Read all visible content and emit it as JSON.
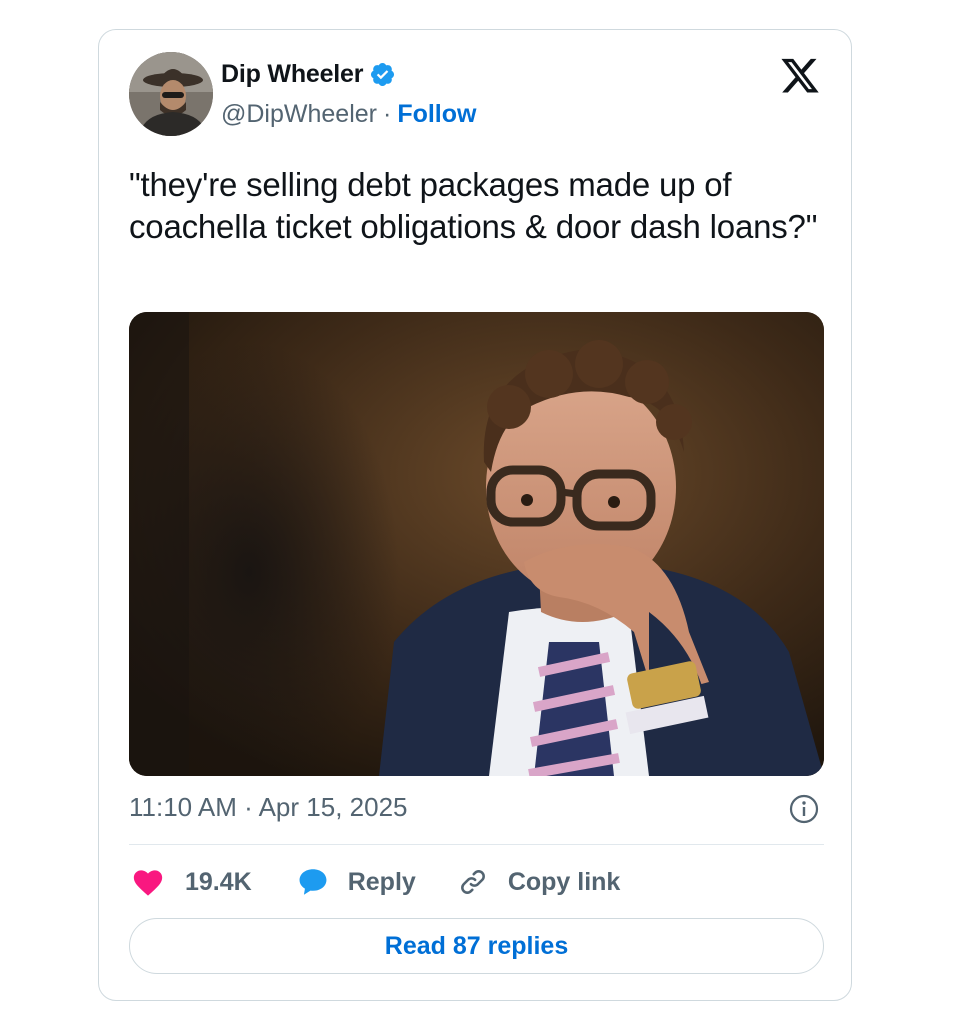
{
  "author": {
    "display_name": "Dip Wheeler",
    "handle": "@DipWheeler",
    "separator": "·",
    "follow_label": "Follow",
    "avatar_icon": "avatar-photo",
    "verified_icon": "verified-badge-icon",
    "verified_color": "#1d9bf0"
  },
  "platform_icon": "x-logo-icon",
  "tweet": {
    "text": "\"they're selling debt packages made up of coachella ticket obligations & door dash loans?\"",
    "media_icon": "tweet-photo",
    "timestamp": "11:10 AM · Apr 15, 2025"
  },
  "actions": {
    "like_count": "19.4K",
    "like_color": "#f91880",
    "reply_label": "Reply",
    "reply_color": "#1d9bf0",
    "copy_label": "Copy link"
  },
  "read_replies_label": "Read 87 replies",
  "colors": {
    "accent": "#006fd6",
    "secondary_text": "#536471",
    "border": "#cfd9de"
  }
}
